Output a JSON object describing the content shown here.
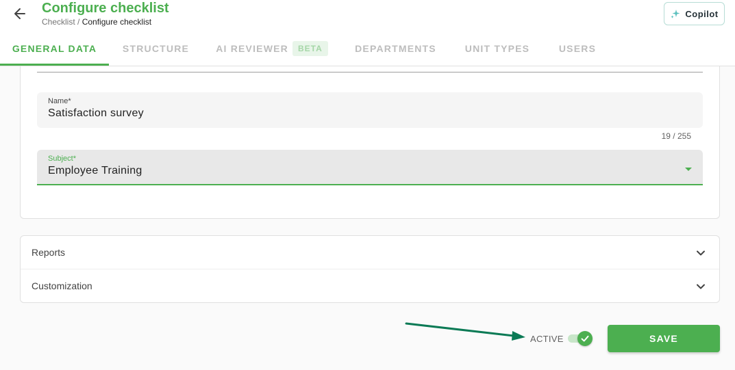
{
  "header": {
    "title": "Configure checklist",
    "breadcrumb": {
      "parent": "Checklist",
      "separator": " / ",
      "current": "Configure checklist"
    },
    "back_icon": "arrow-left-icon",
    "copilot": {
      "label": "Copilot",
      "icon": "sparkle-icon"
    }
  },
  "tabs": [
    {
      "label": "GENERAL DATA",
      "active": true
    },
    {
      "label": "STRUCTURE",
      "active": false
    },
    {
      "label": "AI REVIEWER",
      "badge": "BETA",
      "active": false
    },
    {
      "label": "DEPARTMENTS",
      "active": false
    },
    {
      "label": "UNIT TYPES",
      "active": false
    },
    {
      "label": "USERS",
      "active": false
    }
  ],
  "form": {
    "name": {
      "label": "Name*",
      "value": "Satisfaction survey",
      "counter": "19 / 255"
    },
    "subject": {
      "label": "Subject*",
      "value": "Employee Training",
      "icon": "dropdown-caret-icon"
    }
  },
  "panels": [
    {
      "title": "Reports",
      "icon": "chevron-down-icon"
    },
    {
      "title": "Customization",
      "icon": "chevron-down-icon"
    }
  ],
  "footer": {
    "active_label": "ACTIVE",
    "active_on": true,
    "save_label": "SAVE"
  },
  "colors": {
    "accent": "#4caf50",
    "annotation_arrow": "#0b7a55",
    "tab_inactive": "#bdbdbd"
  }
}
